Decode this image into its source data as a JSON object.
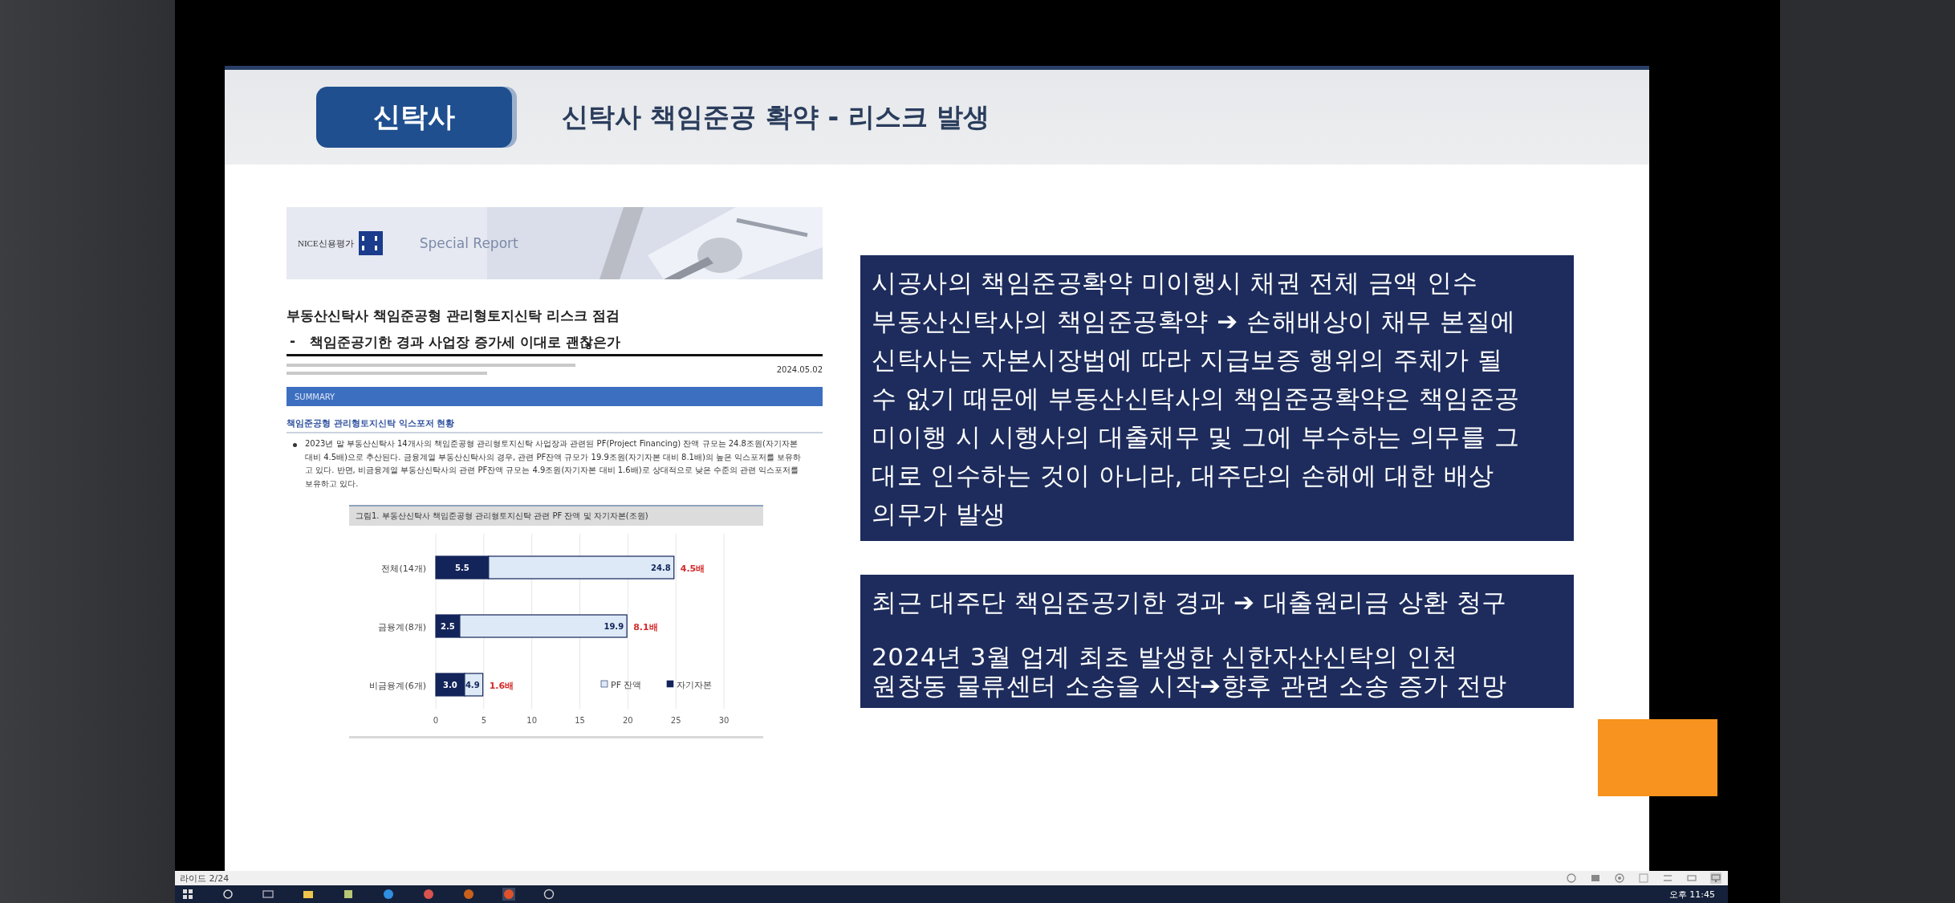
{
  "slide": {
    "badge": "신탁사",
    "title": "신탁사 책임준공 확약 - 리스크 발생",
    "report": {
      "logo": "NICE신용평가",
      "banner": "Special Report",
      "title": "부동산신탁사 책임준공형 관리형토지신탁 리스크 점검",
      "subtitle_marker": "-",
      "subtitle": "책임준공기한 경과 사업장 증가세 이대로 괜찮은가",
      "date": "2024.05.02",
      "section_bar": "SUMMARY",
      "heading": "책임준공형 관리형토지신탁 익스포저 현황",
      "paragraph": "2023년 말 부동산신탁사 14개사의 책임준공형 관리형토지신탁 사업장과 관련된 PF(Project Financing) 잔액 규모는 24.8조원(자기자본 대비 4.5배)으로 추산된다. 금융계열 부동산신탁사의 경우, 관련 PF잔액 규모가 19.9조원(자기자본 대비 8.1배)의 높은 익스포저를 보유하고 있다. 반면, 비금융계열 부동산신탁사의 관련 PF잔액 규모는 4.9조원(자기자본 대비 1.6배)로 상대적으로 낮은 수준의 관련 익스포저를 보유하고 있다.",
      "chart_data": {
        "type": "bar",
        "orientation": "horizontal",
        "title": "그림1. 부동산신탁사 책임준공형 관리형토지신탁 관련 PF 잔액 및 자기자본(조원)",
        "categories": [
          "전체(14개)",
          "금융계(8개)",
          "비금융계(6개)"
        ],
        "series": [
          {
            "name": "자기자본",
            "color": "#13245a",
            "values": [
              5.5,
              2.5,
              3.0
            ]
          },
          {
            "name": "PF 잔액",
            "color": "#dde9f6",
            "values": [
              19.3,
              17.4,
              1.9
            ]
          }
        ],
        "stacked": true,
        "xlim": [
          0,
          30
        ],
        "xticks": [
          0,
          5,
          10,
          15,
          20,
          25,
          30
        ],
        "grid": true,
        "legend": "lower right",
        "value_labels": [
          [
            "5.5",
            "2.5",
            "3.0"
          ],
          [
            "24.8",
            "19.9",
            "4.9"
          ]
        ],
        "annotations": [
          "4.5배",
          "8.1배",
          "1.6배"
        ]
      }
    },
    "boxes": [
      {
        "paragraphs": [
          {
            "lines": [
              "시공사의 책임준공확약 미이행시 채권 전체 금액 인수",
              "부동산신탁사의 책임준공확약 ➔ 손해배상이 채무 본질에",
              "신탁사는 자본시장법에 따라 지급보증 행위의 주체가 될",
              "수 없기 때문에 부동산신탁사의 책임준공확약은 책임준공",
              "미이행 시 시행사의 대출채무 및 그에 부수하는 의무를 그",
              "대로 인수하는 것이 아니라, 대주단의 손해에 대한 배상",
              "의무가 발생"
            ]
          }
        ]
      },
      {
        "paragraphs": [
          {
            "lines": [
              "최근 대주단 책임준공기한 경과 ➔ 대출원리금 상환 청구"
            ]
          },
          {
            "lines": [
              "2024년 3월 업계 최초 발생한 신한자산신탁의 인천",
              "원창동 물류센터 소송을 시작➔향후 관련 소송 증가 전망"
            ]
          }
        ]
      }
    ]
  },
  "status_bar": {
    "slide_counter": "라이드 2/24"
  },
  "taskbar": {
    "clock": "오후 11:45"
  }
}
